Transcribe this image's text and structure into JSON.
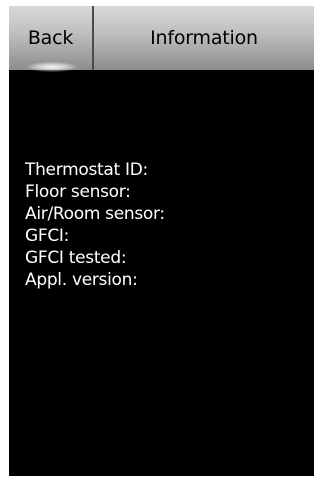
{
  "header": {
    "back_label": "Back",
    "title": "Information"
  },
  "info": {
    "fields": [
      "Thermostat ID:",
      "Floor sensor:",
      "Air/Room sensor:",
      "GFCI:",
      "GFCI tested:",
      "Appl. version:"
    ]
  },
  "colors": {
    "background": "#000000",
    "header": "#bdbdbd",
    "text": "#ffffff"
  }
}
